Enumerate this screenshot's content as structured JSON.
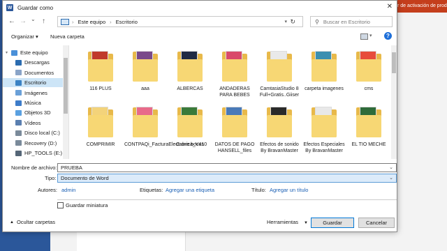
{
  "background": {
    "banner_text": "r de activación de prod"
  },
  "dialog": {
    "title": "Guardar como",
    "title_icon_letter": "W",
    "close_glyph": "✕"
  },
  "nav": {
    "back": "←",
    "forward": "→",
    "recent": "⌄",
    "up": "↑",
    "address": [
      "Este equipo",
      "Escritorio"
    ],
    "address_separator": "›",
    "search_placeholder": "Buscar en Escritorio"
  },
  "toolbar": {
    "organize": "Organizar ▾",
    "new_folder": "Nueva carpeta",
    "help": "?"
  },
  "sidebar": {
    "items": [
      {
        "label": "Este equipo",
        "icon": "computer-icon",
        "color": "#4a90d9"
      },
      {
        "label": "Descargas",
        "icon": "download-icon",
        "color": "#2b6cb0"
      },
      {
        "label": "Documentos",
        "icon": "documents-icon",
        "color": "#8aa4c8"
      },
      {
        "label": "Escritorio",
        "icon": "desktop-icon",
        "color": "#3b82c4"
      },
      {
        "label": "Imágenes",
        "icon": "pictures-icon",
        "color": "#6aa0d8"
      },
      {
        "label": "Música",
        "icon": "music-icon",
        "color": "#3d7cc9"
      },
      {
        "label": "Objetos 3D",
        "icon": "objects3d-icon",
        "color": "#5aa0e0"
      },
      {
        "label": "Vídeos",
        "icon": "videos-icon",
        "color": "#5a7fb0"
      },
      {
        "label": "Disco local (C:)",
        "icon": "drive-icon",
        "color": "#7a8a9a"
      },
      {
        "label": "Recovery (D:)",
        "icon": "drive-icon",
        "color": "#7a8a9a"
      },
      {
        "label": "HP_TOOLS (E:)",
        "icon": "drive-icon",
        "color": "#556677"
      }
    ],
    "selected": "Escritorio"
  },
  "files": [
    {
      "label": "116 PLUS",
      "paper_color": "#c0392b"
    },
    {
      "label": "aaa",
      "paper_color": "#7a4a8a"
    },
    {
      "label": "ALBERCAS",
      "paper_color": "#1f2a44"
    },
    {
      "label": "ANDADERAS PARA BEBES",
      "paper_color": "#d94a6a"
    },
    {
      "label": "CamtasiaStudio 8 Full+Gratis..Giiser",
      "paper_color": "#e9e9e9"
    },
    {
      "label": "carpeta imagenes",
      "paper_color": "#3b8fb0"
    },
    {
      "label": "cms",
      "paper_color": "#e74c3c"
    },
    {
      "label": "COMPRIMIR",
      "paper_color": "#f3d37a"
    },
    {
      "label": "CONTPAQi_FacturaElectronica_V410",
      "paper_color": "#e86a8a"
    },
    {
      "label": "Cubre bocas",
      "paper_color": "#3a7a3a"
    },
    {
      "label": "DATOS DE PAGO HANSELL_files",
      "paper_color": "#4a7ab8"
    },
    {
      "label": "Efectos de sonido By BravanMaster",
      "paper_color": "#2a2a2a"
    },
    {
      "label": "Efectos Especiales By BravanMaster",
      "paper_color": "#e8e8e8"
    },
    {
      "label": "EL TIO MECHE",
      "paper_color": "#2f6b3a"
    }
  ],
  "form": {
    "filename_label": "Nombre de archivo:",
    "filename_value": "PRUEBA",
    "type_label": "Tipo:",
    "type_value": "Documento de Word",
    "authors_label": "Autores:",
    "authors_value": "admin",
    "tags_label": "Etiquetas:",
    "tags_value": "Agregar una etiqueta",
    "title_label": "Título:",
    "title_value": "Agregar un título",
    "thumbnail_label": "Guardar miniatura"
  },
  "footer": {
    "hide_folders": "Ocultar carpetas",
    "tools": "Herramientas",
    "save": "Guardar",
    "cancel": "Cancelar"
  }
}
